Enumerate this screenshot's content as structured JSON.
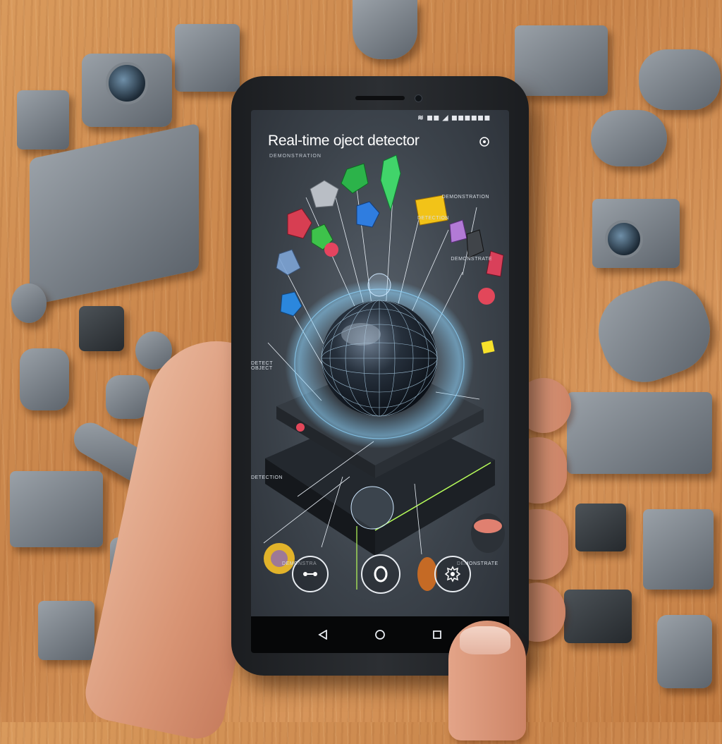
{
  "app": {
    "title": "Real-time oject detector",
    "subtitle": "DEMONSTRATION",
    "status_text": "≋ ◼︎◼ ◢ ◼◼◼◼◼◼",
    "labels": {
      "top_right": "DEMONSTRATION",
      "top_mid": "DETECTION",
      "mid_right": "DEMONSTRATE",
      "left_mid": "DETECT OBJECT",
      "lower_left": "DETECTION",
      "bottom_left": "DEMONSTRA",
      "bottom_right": "DEMONSTRATE"
    }
  },
  "buttons": {
    "left_icon": "connect-icon",
    "center_icon": "capture-icon",
    "right_icon": "gear-icon"
  },
  "nav": {
    "back_icon": "back-icon",
    "home_icon": "home-icon",
    "recents_icon": "recents-icon"
  },
  "colors": {
    "screen_bg": "#3c434b",
    "accent": "#8fd6ff",
    "text": "#ffffff"
  }
}
